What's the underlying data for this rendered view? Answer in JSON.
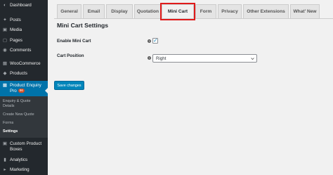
{
  "sidebar": {
    "items": [
      {
        "label": "Dashboard",
        "icon": "dashboard-icon"
      },
      {
        "label": "Posts",
        "icon": "pin-icon"
      },
      {
        "label": "Media",
        "icon": "media-icon"
      },
      {
        "label": "Pages",
        "icon": "pages-icon"
      },
      {
        "label": "Comments",
        "icon": "comment-icon"
      },
      {
        "label": "WooCommerce",
        "icon": "woocommerce-icon"
      },
      {
        "label": "Products",
        "icon": "products-icon"
      },
      {
        "label_line1": "Product Enquiry",
        "label_line2": "Pro",
        "badge": "96",
        "icon": "plugin-icon"
      },
      {
        "label_line1": "Custom Product",
        "label_line2": "Boxes",
        "icon": "box-icon"
      },
      {
        "label": "Analytics",
        "icon": "analytics-icon"
      },
      {
        "label": "Marketing",
        "icon": "megaphone-icon"
      }
    ],
    "submenu": {
      "items": [
        {
          "label_line1": "Enquiry & Quote",
          "label_line2": "Details"
        },
        {
          "label": "Create New Quote"
        },
        {
          "label": "Forms"
        },
        {
          "label": "Settings",
          "current": true
        }
      ]
    }
  },
  "tabs": [
    "General",
    "Email",
    "Display",
    "Quotation",
    "Mini Cart",
    "Form",
    "Privacy",
    "Other Extensions",
    "What' New"
  ],
  "active_tab": "Mini Cart",
  "highlight_color": "#e01b1b",
  "section": {
    "title": "Mini Cart Settings",
    "fields": {
      "enable": {
        "label": "Enable Mini Cart",
        "checked": true
      },
      "position": {
        "label": "Cart Position",
        "value": "Right"
      }
    }
  },
  "save_button": {
    "label": "Save changes"
  },
  "colors": {
    "sidebar_bg": "#23282d",
    "accent": "#0073aa",
    "button": "#0085ba",
    "badge": "#d54e21"
  }
}
